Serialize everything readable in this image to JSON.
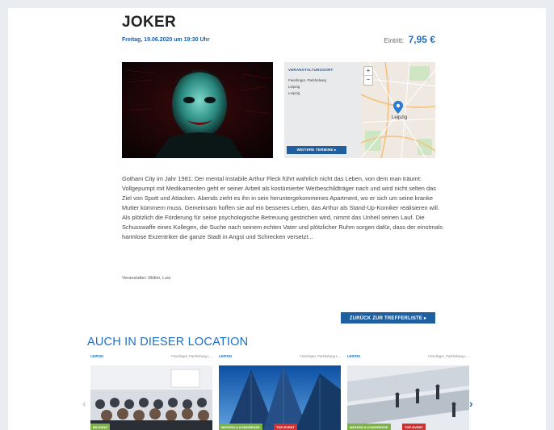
{
  "event": {
    "title": "JOKER",
    "date": "Freitag, 19.06.2020 um 19:30 Uhr",
    "price_label": "Eintritt:",
    "price": "7,95 €"
  },
  "venue": {
    "label": "VERANSTALTUNGSORT",
    "lines": [
      "Feierlinger, Parkhelweg",
      "Leipzig",
      "Leipzig"
    ],
    "more_button": "WEITERE TERMINE ▸",
    "map_city": "Leipzig",
    "zoom_in": "+",
    "zoom_out": "−"
  },
  "description": "Gotham City im Jahr 1981: Der mental instabile Arthur Fleck führt wahrlich nicht das Leben, von dem man träumt: Vollgepumpt mit Medikamenten geht er seiner Arbeit als kostümierter Werbeschildträger nach und wird nicht selten das Ziel von Spott und Attacken. Abends zieht es ihn in sein heruntergekommenes Apartment, wo er sich um seine kranke Mutter kümmern muss. Gemeinsam hoffen sie auf ein besseres Leben, das Arthur als Stand-Up-Komiker realisieren will. Als plötzlich die Förderung für seine psychologische Betreuung gestrichen wird, nimmt das Unheil seinen Lauf. Die Schusswaffe eines Kollegen, die Suche nach seinem echten Vater und plötzlicher Ruhm sorgen dafür, dass der einstmals harmlose Exzentriker die ganze Stadt in Angst und Schrecken versetzt...",
  "organizer": "Veranstalter: Müller, Lutz",
  "back_button": "ZURÜCK ZUR TREFFERLISTE ▸",
  "section_title": "AUCH IN DIESER LOCATION",
  "cards": [
    {
      "city": "LEIPZIG",
      "venue": "Feierlinger, Parkhelweg L...",
      "tags": [
        "BILDUNG"
      ]
    },
    {
      "city": "LEIPZIG",
      "venue": "Feierlinger, Parkhelweg L...",
      "tags": [
        "MESSEN & KONGRESSE",
        "TOP-EVENT"
      ]
    },
    {
      "city": "LEIPZIG",
      "venue": "Feierlinger, Parkhelweg L...",
      "tags": [
        "MESSEN & KONGRESSE",
        "TOP-EVENT"
      ]
    }
  ],
  "nav": {
    "prev": "‹",
    "next": "›"
  },
  "colors": {
    "accent": "#1f6fbf",
    "button": "#1f5e9f",
    "tag_green": "#7cb342",
    "tag_red": "#d32f2f"
  },
  "icons": [
    "map-pin-icon",
    "chevron-left-icon",
    "chevron-right-icon"
  ]
}
